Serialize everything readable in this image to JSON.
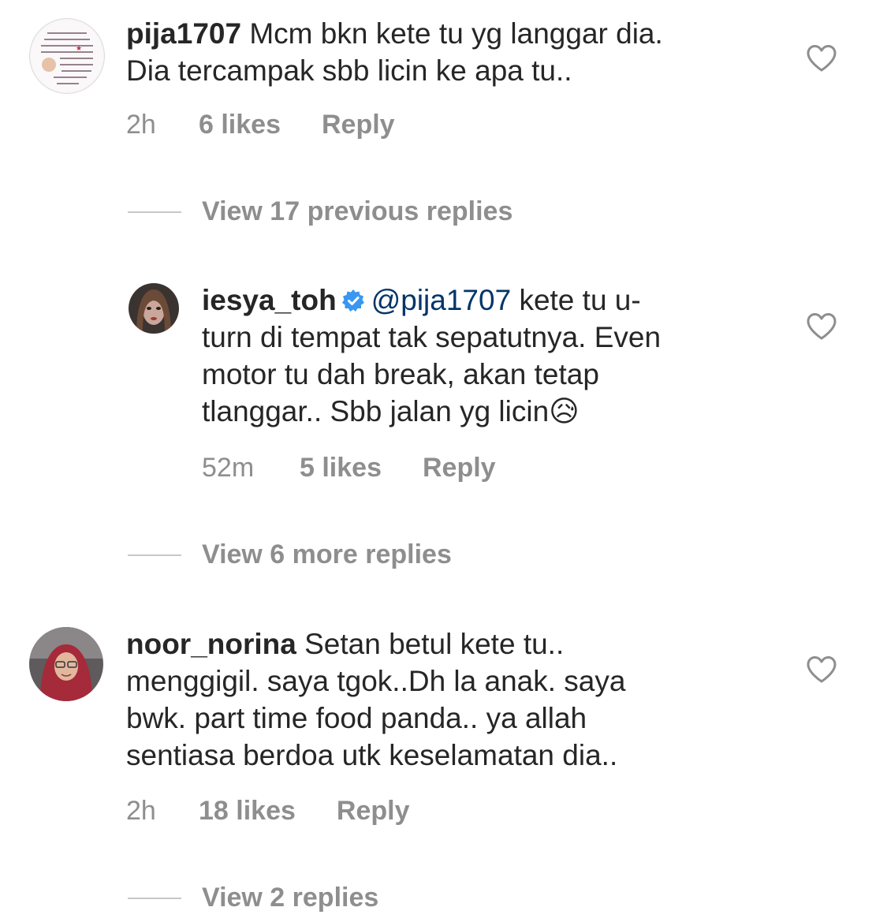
{
  "comments": [
    {
      "username": "pija1707",
      "text_line1": "Mcm bkn kete tu yg langgar dia.",
      "text_line2": "Dia tercampak sbb licin ke apa tu..",
      "time": "2h",
      "likes": "6 likes",
      "reply": "Reply",
      "thread_link": "View 17 previous replies"
    },
    {
      "username": "iesya_toh",
      "mention": "@pija1707",
      "text_line1": " kete tu u-",
      "text_line2": "turn di tempat tak sepatutnya. Even",
      "text_line3": "motor tu dah break, akan tetap",
      "text_line4": "tlanggar.. Sbb jalan yg licin",
      "emoji": "😥",
      "time": "52m",
      "likes": "5 likes",
      "reply": "Reply",
      "thread_link": "View 6 more replies"
    },
    {
      "username": "noor_norina",
      "text_line1": "Setan betul kete tu..",
      "text_line2": "menggigil. saya tgok..Dh la anak. saya",
      "text_line3": "bwk. part time food panda.. ya allah",
      "text_line4": "sentiasa berdoa utk keselamatan dia..",
      "time": "2h",
      "likes": "18 likes",
      "reply": "Reply",
      "thread_link": "View 2 replies"
    }
  ],
  "colors": {
    "text": "#262626",
    "muted": "#8e8e8e",
    "mention": "#003569",
    "verified": "#3897f0"
  },
  "icons": {
    "like": "heart-outline-icon",
    "verified": "verified-badge-icon"
  }
}
